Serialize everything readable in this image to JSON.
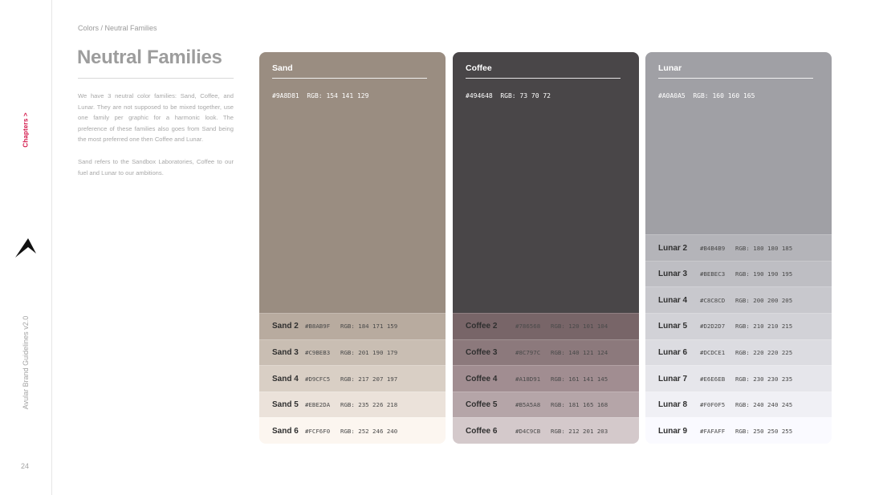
{
  "sidebar": {
    "chapters_label": "Chapters >",
    "vertical_title": "Avular Brand Guidelines v2.0",
    "page_number": "24"
  },
  "breadcrumb": "Colors / Neutral Families",
  "title": "Neutral Families",
  "paragraphs": [
    "We have 3 neutral color families: Sand, Coffee, and Lunar. They are not supposed to be mixed together, use one family per graphic for a harmonic look. The preference of these families also goes from Sand being the most preferred one then Coffee and Lunar.",
    "Sand refers to the Sandbox Laboratories, Coffee to our fuel and Lunar to our ambitions."
  ],
  "families": {
    "sand": {
      "name": "Sand",
      "primary_hex": "#9A8D81",
      "primary_rgb": "RGB: 154 141 129",
      "color": "#9A8D81",
      "shades": [
        {
          "name": "Sand 2",
          "hex": "#B8AB9F",
          "rgb": "RGB: 184 171 159",
          "color": "#B8AB9F"
        },
        {
          "name": "Sand 3",
          "hex": "#C9BEB3",
          "rgb": "RGB: 201 190 179",
          "color": "#C9BEB3"
        },
        {
          "name": "Sand 4",
          "hex": "#D9CFC5",
          "rgb": "RGB: 217 207 197",
          "color": "#D9CFC5"
        },
        {
          "name": "Sand 5",
          "hex": "#EBE2DA",
          "rgb": "RGB: 235 226 218",
          "color": "#EBE2DA"
        },
        {
          "name": "Sand 6",
          "hex": "#FCF6F0",
          "rgb": "RGB: 252 246 240",
          "color": "#FCF6F0"
        }
      ]
    },
    "coffee": {
      "name": "Coffee",
      "primary_hex": "#494648",
      "primary_rgb": "RGB: 73 70 72",
      "color": "#494648",
      "shades": [
        {
          "name": "Coffee 2",
          "hex": "#786568",
          "rgb": "RGB: 120 101 104",
          "color": "#786568"
        },
        {
          "name": "Coffee 3",
          "hex": "#8C797C",
          "rgb": "RGB: 140 121 124",
          "color": "#8C797C"
        },
        {
          "name": "Coffee 4",
          "hex": "#A18D91",
          "rgb": "RGB: 161 141 145",
          "color": "#A18D91"
        },
        {
          "name": "Coffee 5",
          "hex": "#B5A5A8",
          "rgb": "RGB: 181 165 168",
          "color": "#B5A5A8"
        },
        {
          "name": "Coffee 6",
          "hex": "#D4C9CB",
          "rgb": "RGB: 212 201 203",
          "color": "#D4C9CB"
        }
      ]
    },
    "lunar": {
      "name": "Lunar",
      "primary_hex": "#A0A0A5",
      "primary_rgb": "RGB: 160 160 165",
      "color": "#A0A0A5",
      "shades": [
        {
          "name": "Lunar 2",
          "hex": "#B4B4B9",
          "rgb": "RGB: 180 180 185",
          "color": "#B4B4B9"
        },
        {
          "name": "Lunar 3",
          "hex": "#BEBEC3",
          "rgb": "RGB: 190 190 195",
          "color": "#BEBEC3"
        },
        {
          "name": "Lunar 4",
          "hex": "#C8C8CD",
          "rgb": "RGB: 200 200 205",
          "color": "#C8C8CD"
        },
        {
          "name": "Lunar 5",
          "hex": "#D2D2D7",
          "rgb": "RGB: 210 210 215",
          "color": "#D2D2D7"
        },
        {
          "name": "Lunar 6",
          "hex": "#DCDCE1",
          "rgb": "RGB: 220 220 225",
          "color": "#DCDCE1"
        },
        {
          "name": "Lunar 7",
          "hex": "#E6E6EB",
          "rgb": "RGB: 230 230 235",
          "color": "#E6E6EB"
        },
        {
          "name": "Lunar 8",
          "hex": "#F0F0F5",
          "rgb": "RGB: 240 240 245",
          "color": "#F0F0F5"
        },
        {
          "name": "Lunar 9",
          "hex": "#FAFAFF",
          "rgb": "RGB: 250 250 255",
          "color": "#FAFAFF"
        }
      ]
    }
  },
  "accent_color": "#D3174A"
}
